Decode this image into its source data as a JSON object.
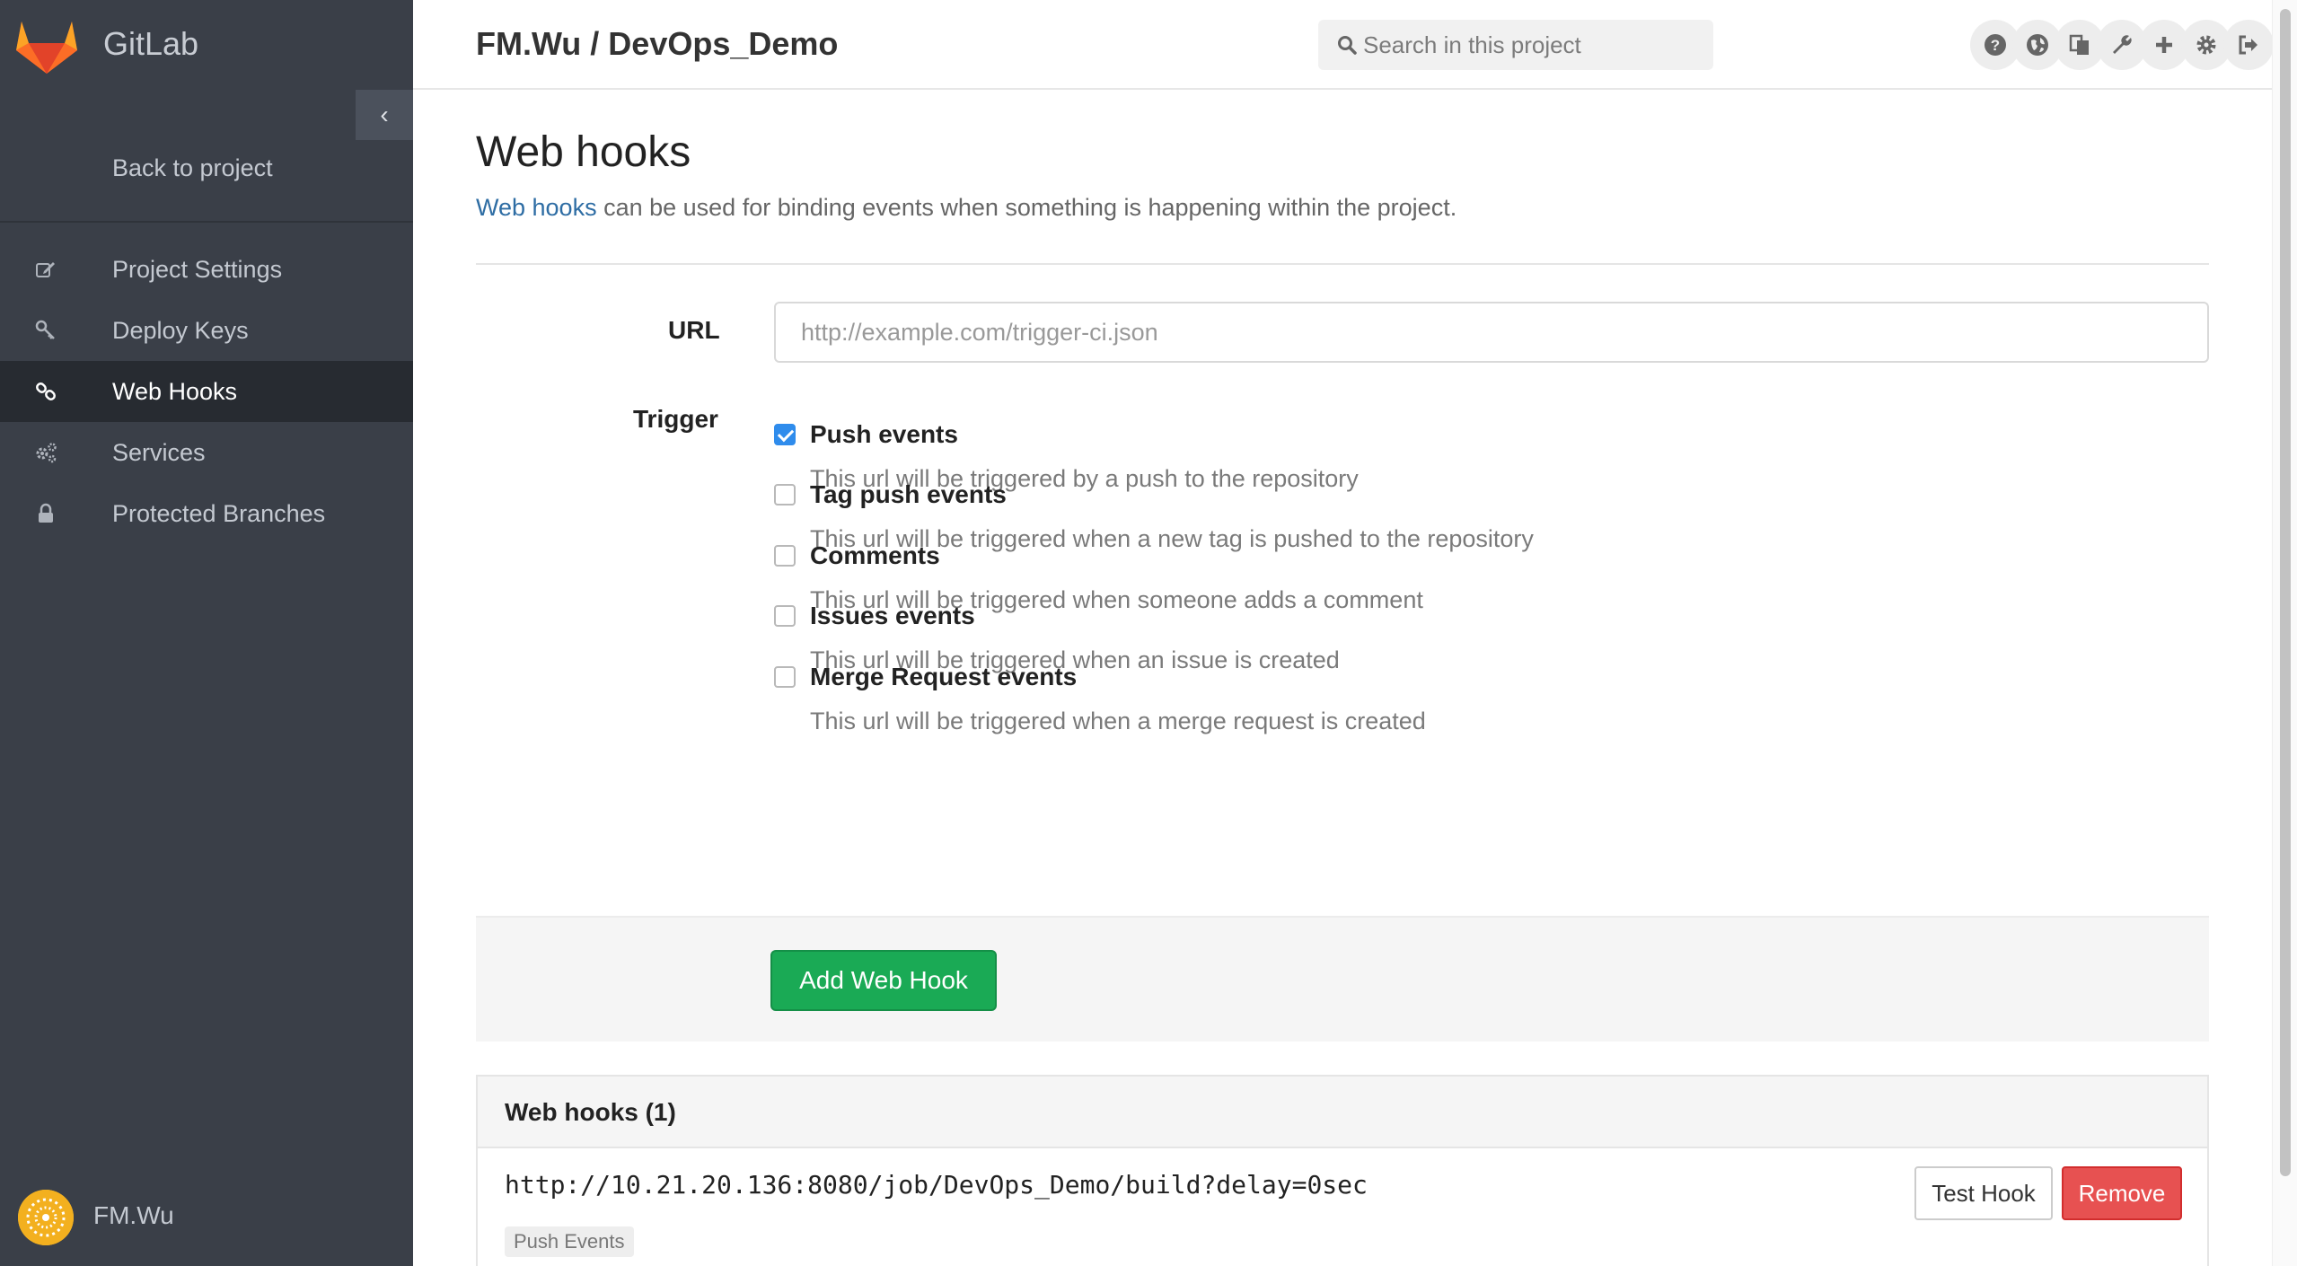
{
  "app": {
    "name": "GitLab"
  },
  "header": {
    "project_title": "FM.Wu / DevOps_Demo",
    "search_placeholder": "Search in this project",
    "icons": [
      "help-icon",
      "globe-icon",
      "copy-icon",
      "wrench-icon",
      "plus-icon",
      "gear-icon",
      "sign-out-icon"
    ]
  },
  "sidebar": {
    "back_link": "Back to project",
    "items": [
      {
        "label": "Project Settings",
        "icon": "edit-icon",
        "active": false
      },
      {
        "label": "Deploy Keys",
        "icon": "key-icon",
        "active": false
      },
      {
        "label": "Web Hooks",
        "icon": "link-icon",
        "active": true
      },
      {
        "label": "Services",
        "icon": "cogs-icon",
        "active": false
      },
      {
        "label": "Protected Branches",
        "icon": "lock-icon",
        "active": false
      }
    ],
    "user_name": "FM.Wu"
  },
  "page": {
    "title": "Web hooks",
    "intro_link": "Web hooks",
    "intro_text": " can be used for binding events when something is happening within the project."
  },
  "form": {
    "url_label": "URL",
    "url_placeholder": "http://example.com/trigger-ci.json",
    "url_value": "",
    "trigger_label": "Trigger",
    "triggers": [
      {
        "title": "Push events",
        "description": "This url will be triggered by a push to the repository",
        "checked": true
      },
      {
        "title": "Tag push events",
        "description": "This url will be triggered when a new tag is pushed to the repository",
        "checked": false
      },
      {
        "title": "Comments",
        "description": "This url will be triggered when someone adds a comment",
        "checked": false
      },
      {
        "title": "Issues events",
        "description": "This url will be triggered when an issue is created",
        "checked": false
      },
      {
        "title": "Merge Request events",
        "description": "This url will be triggered when a merge request is created",
        "checked": false
      }
    ],
    "submit_label": "Add Web Hook"
  },
  "hooks": {
    "title": "Web hooks (1)",
    "items": [
      {
        "url": "http://10.21.20.136:8080/job/DevOps_Demo/build?delay=0sec",
        "badge": "Push Events",
        "test_label": "Test Hook",
        "remove_label": "Remove"
      }
    ]
  },
  "colors": {
    "sidebar_bg": "#3a3f48",
    "sidebar_active_bg": "#272b31",
    "success": "#1aaa55",
    "danger": "#e75151",
    "link": "#2e6da4",
    "checkbox_checked": "#2f8cec"
  }
}
